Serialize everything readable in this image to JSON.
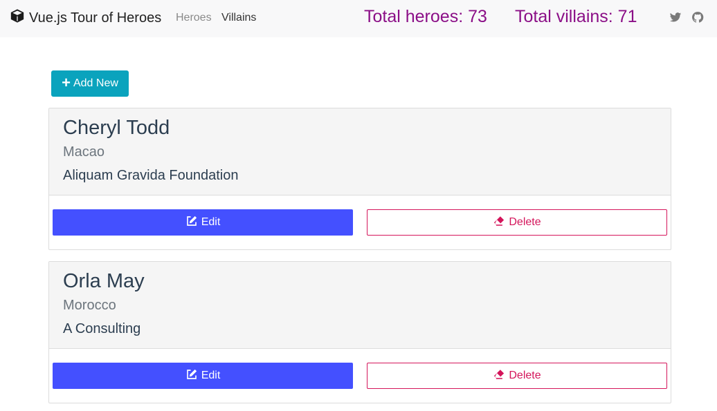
{
  "navbar": {
    "brand_title": "Vue.js Tour of Heroes",
    "brand_icon": "cube-icon",
    "links": [
      {
        "label": "Heroes",
        "active": false
      },
      {
        "label": "Villains",
        "active": true
      }
    ],
    "total_heroes_label": "Total heroes: 73",
    "total_villains_label": "Total villains: 71",
    "social": [
      {
        "icon": "twitter-icon"
      },
      {
        "icon": "github-icon"
      }
    ]
  },
  "toolbar": {
    "add_label": "Add New",
    "add_icon": "plus-icon"
  },
  "cards": [
    {
      "name": "Cheryl Todd",
      "country": "Macao",
      "company": "Aliquam Gravida Foundation",
      "edit_label": "Edit",
      "delete_label": "Delete"
    },
    {
      "name": "Orla May",
      "country": "Morocco",
      "company": "A Consulting",
      "edit_label": "Edit",
      "delete_label": "Delete"
    }
  ],
  "colors": {
    "accent_stats": "#8b0f87",
    "add_button": "#0aa3bd",
    "edit_button": "#4450ff",
    "delete_button": "#d4145a"
  }
}
